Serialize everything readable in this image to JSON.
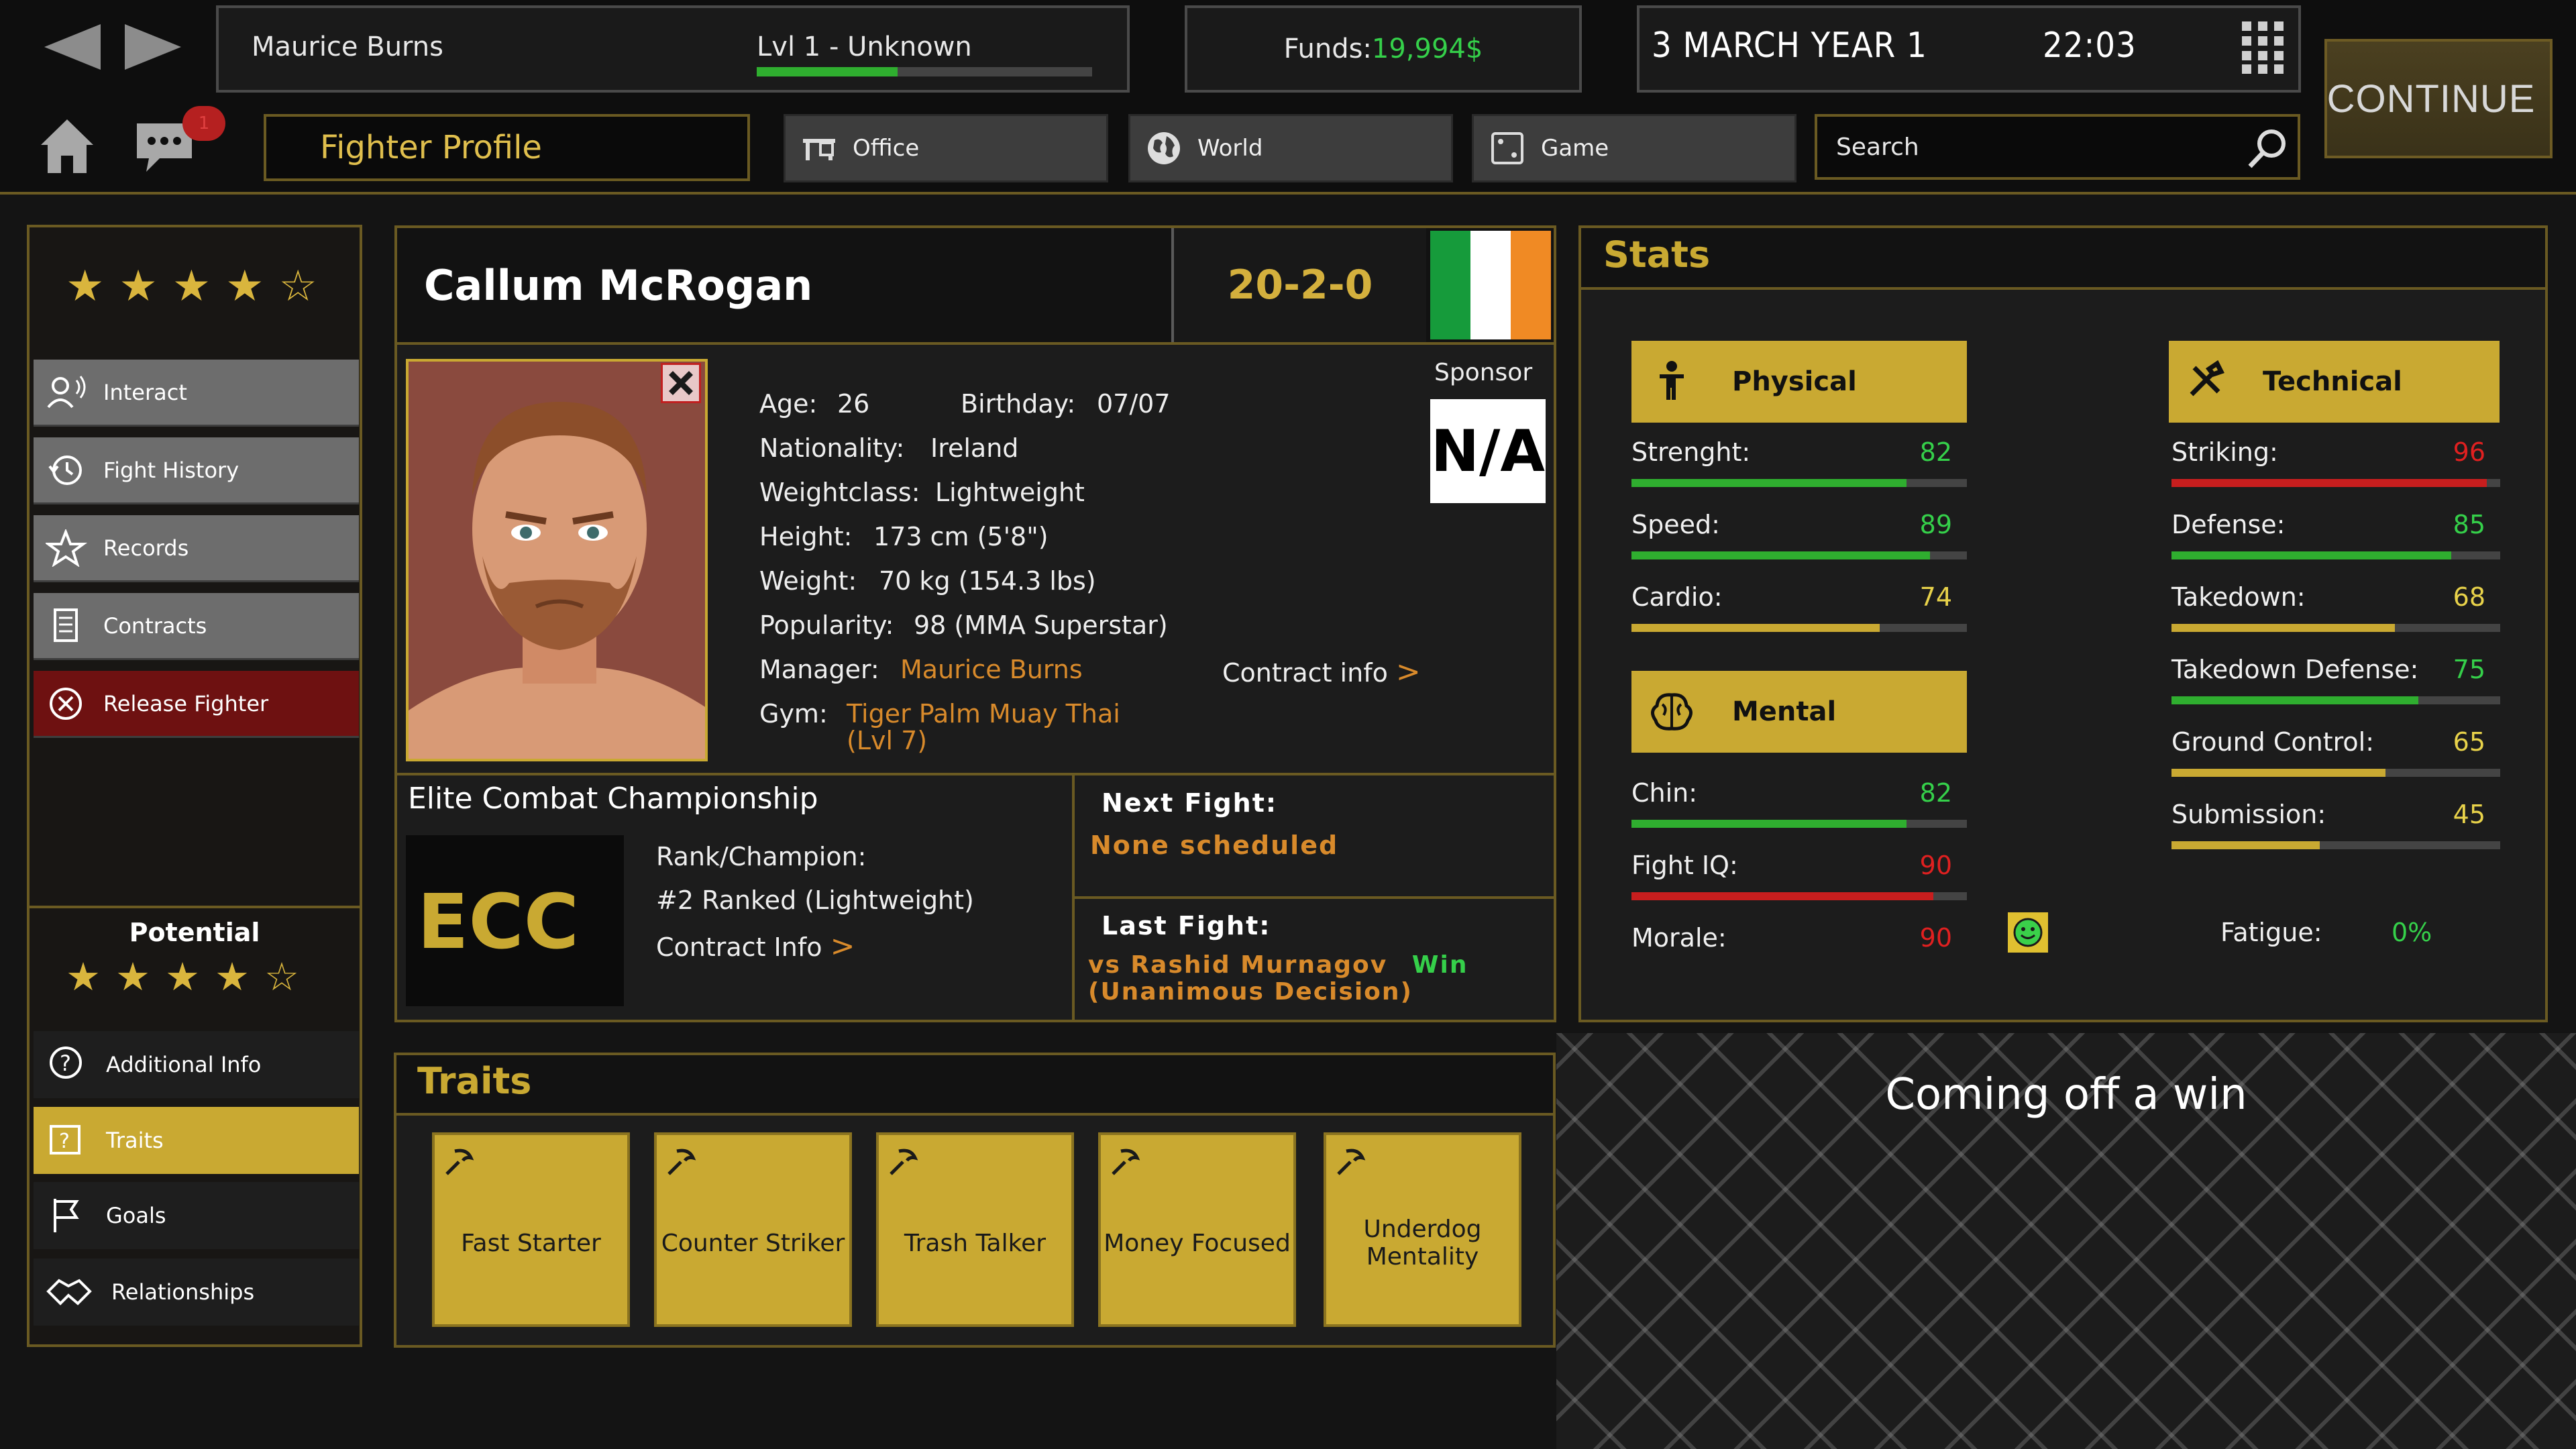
{
  "topbar": {
    "manager_name": "Maurice Burns",
    "level": "Lvl 1 - Unknown",
    "level_progress": 0.42,
    "funds_label": "Funds: ",
    "funds_value": "19,994$",
    "date": "3 MARCH YEAR 1",
    "time": "22:03",
    "continue_label": "CONTINUE",
    "page_title": "Fighter Profile",
    "tabs": [
      "Office",
      "World",
      "Game"
    ],
    "search_placeholder": "Search",
    "notification_count": "1"
  },
  "sidebar": {
    "rating_stars": 5,
    "items": [
      {
        "label": "Interact"
      },
      {
        "label": "Fight History"
      },
      {
        "label": "Records"
      },
      {
        "label": "Contracts"
      },
      {
        "label": "Release Fighter"
      }
    ],
    "potential_label": "Potential",
    "potential_stars": 5,
    "bottom_items": [
      {
        "label": "Additional Info"
      },
      {
        "label": "Traits"
      },
      {
        "label": "Goals"
      },
      {
        "label": "Relationships"
      }
    ]
  },
  "profile": {
    "name": "Callum McRogan",
    "record": "20-2-0",
    "sponsor_label": "Sponsor",
    "sponsor_value": "N/A",
    "age_label": "Age:",
    "age": "26",
    "birthday_label": "Birthday:",
    "birthday": "07/07",
    "nationality_label": "Nationality:",
    "nationality": "Ireland",
    "weightclass_label": "Weightclass:",
    "weightclass": "Lightweight",
    "height_label": "Height:",
    "height": "173 cm (5'8\")",
    "weight_label": "Weight:",
    "weight": "70 kg (154.3 lbs)",
    "popularity_label": "Popularity:",
    "popularity": "98 (MMA Superstar)",
    "manager_label": "Manager:",
    "manager": "Maurice Burns",
    "gym_label": "Gym:",
    "gym": "Tiger Palm Muay Thai",
    "gym_level": "(Lvl 7)",
    "contract_info_label": "Contract info",
    "arrow": ">",
    "org_name": "Elite Combat Championship",
    "org_logo_text": "ECC",
    "rank_label": "Rank/Champion:",
    "rank_value": "#2 Ranked (Lightweight)",
    "org_contract_label": "Contract Info",
    "next_fight_label": "Next Fight:",
    "next_fight_value": "None scheduled",
    "last_fight_label": "Last Fight:",
    "last_fight_opponent": "vs Rashid Murnagov",
    "last_fight_result": "Win",
    "last_fight_method": "(Unanimous Decision)"
  },
  "stats": {
    "title": "Stats",
    "physical_label": "Physical",
    "technical_label": "Technical",
    "mental_label": "Mental",
    "physical": [
      {
        "name": "Strenght:",
        "value": "82",
        "color": "#35d04a",
        "bar": "#2fae2f"
      },
      {
        "name": "Speed:",
        "value": "89",
        "color": "#35d04a",
        "bar": "#2fae2f"
      },
      {
        "name": "Cardio:",
        "value": "74",
        "color": "#e8d24a",
        "bar": "#c9a932"
      }
    ],
    "mental": [
      {
        "name": "Chin:",
        "value": "82",
        "color": "#35d04a",
        "bar": "#2fae2f"
      },
      {
        "name": "Fight IQ:",
        "value": "90",
        "color": "#e02020",
        "bar": "#c81e1e"
      }
    ],
    "morale_label": "Morale:",
    "morale_value": "90",
    "technical": [
      {
        "name": "Striking:",
        "value": "96",
        "color": "#e02020",
        "bar": "#c81e1e"
      },
      {
        "name": "Defense:",
        "value": "85",
        "color": "#35d04a",
        "bar": "#2fae2f"
      },
      {
        "name": "Takedown:",
        "value": "68",
        "color": "#e8d24a",
        "bar": "#c9a932"
      },
      {
        "name": "Takedown Defense:",
        "value": "75",
        "color": "#35d04a",
        "bar": "#2fae2f"
      },
      {
        "name": "Ground Control:",
        "value": "65",
        "color": "#e8d24a",
        "bar": "#c9a932"
      },
      {
        "name": "Submission:",
        "value": "45",
        "color": "#e8d24a",
        "bar": "#c9a932"
      }
    ],
    "fatigue_label": "Fatigue:",
    "fatigue_value": "0%"
  },
  "traits": {
    "title": "Traits",
    "items": [
      "Fast Starter",
      "Counter Striker",
      "Trash Talker",
      "Money Focused",
      "Underdog Mentality"
    ]
  },
  "status_text": "Coming off a win"
}
